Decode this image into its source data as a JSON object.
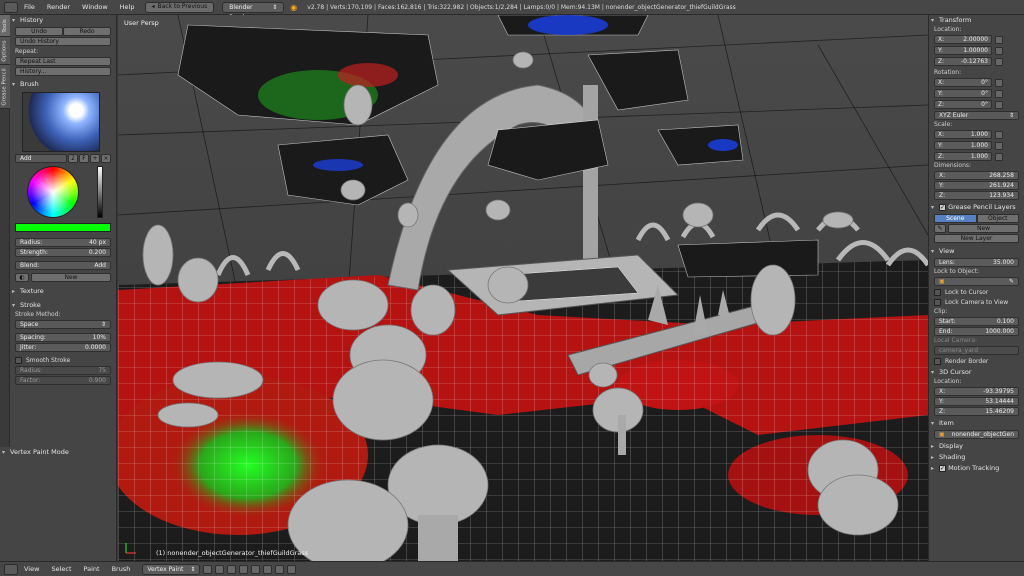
{
  "topbar": {
    "menus": [
      "File",
      "Render",
      "Window",
      "Help"
    ],
    "back_button": "Back to Previous",
    "render_engine": "Blender Render",
    "stats": "v2.78 | Verts:170,109 | Faces:162,816 | Tris:322,982 | Objects:1/2,284 | Lamps:0/0 | Mem:94.13M | nonender_objectGenerator_thiefGuildGrass"
  },
  "left_tabs": [
    "Tools",
    "Options",
    "Grease Pencil"
  ],
  "history": {
    "title": "History",
    "undo": "Undo",
    "redo": "Redo",
    "undo_history": "Undo History",
    "repeat_label": "Repeat:",
    "repeat_last": "Repeat Last",
    "history_btn": "History..."
  },
  "brush": {
    "title": "Brush",
    "name": "Add",
    "users": "2",
    "fake_user": "F",
    "radius_label": "Radius:",
    "radius_value": "40 px",
    "strength_label": "Strength:",
    "strength_value": "0.200",
    "blend_label": "Blend:",
    "blend_value": "Add",
    "new_btn": "New",
    "color": "#00ff00"
  },
  "texture": {
    "title": "Texture"
  },
  "stroke": {
    "title": "Stroke",
    "method_label": "Stroke Method:",
    "method_value": "Space",
    "spacing_label": "Spacing:",
    "spacing_value": "10%",
    "jitter_label": "Jitter:",
    "jitter_value": "0.0000",
    "smooth_label": "Smooth Stroke",
    "smooth_radius_label": "Radius:",
    "smooth_radius_value": "75",
    "smooth_factor_label": "Factor:",
    "smooth_factor_value": "0.900"
  },
  "mode_panel": {
    "title": "Vertex Paint Mode"
  },
  "viewport": {
    "view_label": "User Persp",
    "object_label": "(1) nonender_objectGenerator_thiefGuildGrass"
  },
  "transform": {
    "title": "Transform",
    "location_label": "Location:",
    "location": [
      {
        "axis": "X:",
        "value": "2.00000"
      },
      {
        "axis": "Y:",
        "value": "1.00000"
      },
      {
        "axis": "Z:",
        "value": "-0.12763"
      }
    ],
    "rotation_label": "Rotation:",
    "rotation": [
      {
        "axis": "X:",
        "value": "0°"
      },
      {
        "axis": "Y:",
        "value": "0°"
      },
      {
        "axis": "Z:",
        "value": "0°"
      }
    ],
    "rotation_mode": "XYZ Euler",
    "scale_label": "Scale:",
    "scale": [
      {
        "axis": "X:",
        "value": "1.000"
      },
      {
        "axis": "Y:",
        "value": "1.000"
      },
      {
        "axis": "Z:",
        "value": "1.000"
      }
    ],
    "dimensions_label": "Dimensions:",
    "dimensions": [
      {
        "axis": "X:",
        "value": "268.258"
      },
      {
        "axis": "Y:",
        "value": "261.924"
      },
      {
        "axis": "Z:",
        "value": "123.934"
      }
    ]
  },
  "grease_pencil": {
    "title": "Grease Pencil Layers",
    "tab_scene": "Scene",
    "tab_object": "Object",
    "new_btn": "New",
    "new_layer_btn": "New Layer"
  },
  "view": {
    "title": "View",
    "lens_label": "Lens:",
    "lens_value": "35.000",
    "lock_to_object_label": "Lock to Object:",
    "lock_to_cursor": "Lock to Cursor",
    "lock_camera": "Lock Camera to View",
    "clip_label": "Clip:",
    "clip_start_label": "Start:",
    "clip_start_value": "0.100",
    "clip_end_label": "End:",
    "clip_end_value": "1000.000",
    "local_camera_label": "Local Camera:",
    "local_camera_value": "camera_yard",
    "render_border": "Render Border"
  },
  "cursor3d": {
    "title": "3D Cursor",
    "location_label": "Location:",
    "location": [
      {
        "axis": "X:",
        "value": "-93.39795"
      },
      {
        "axis": "Y:",
        "value": "53.14444"
      },
      {
        "axis": "Z:",
        "value": "15.46209"
      }
    ]
  },
  "item": {
    "title": "Item",
    "name": "nonender_objectGen"
  },
  "display": {
    "title": "Display"
  },
  "shading": {
    "title": "Shading"
  },
  "motion_tracking": {
    "title": "Motion Tracking"
  },
  "bottombar": {
    "menus": [
      "View",
      "Select",
      "Paint",
      "Brush"
    ],
    "mode": "Vertex Paint"
  }
}
